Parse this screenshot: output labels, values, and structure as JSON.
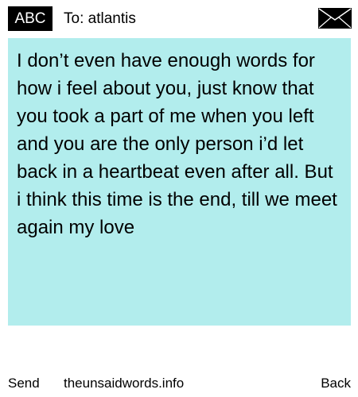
{
  "header": {
    "badge_label": "ABC",
    "recipient": "To: atlantis",
    "envelope_icon": "envelope-icon"
  },
  "message": {
    "text": "I don’t even have enough words for how i feel about you, just know that you took a part of me when you left and you are the only person i’d let back in a heartbeat even after all. But i think this time is the end, till we meet again my love",
    "background_color": "#b2eded"
  },
  "footer": {
    "send_label": "Send",
    "site_label": "theunsaidwords.info",
    "back_label": "Back"
  }
}
